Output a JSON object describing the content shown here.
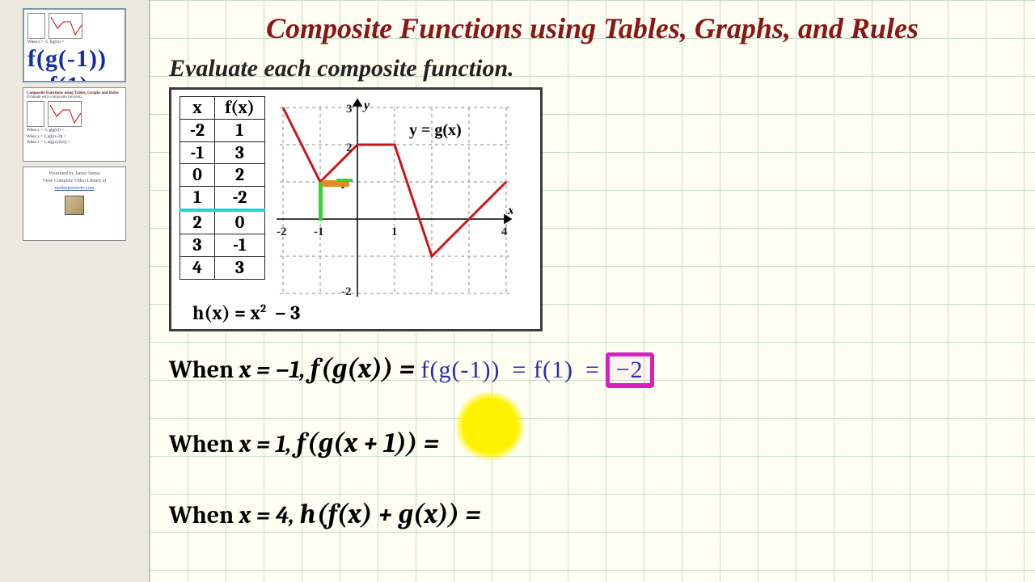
{
  "title": "Composite Functions using Tables, Graphs, and Rules",
  "subtitle": "Evaluate each composite function.",
  "sidebar": {
    "thumbs": [
      {
        "label": "slide-1"
      },
      {
        "label": "slide-2"
      },
      {
        "label": "slide-3-credits"
      }
    ],
    "credits": {
      "by": "Presented by James Sousa",
      "lib": "View Complete Video Library at"
    }
  },
  "table": {
    "head_x": "x",
    "head_fx": "f(x)",
    "rows": [
      {
        "x": "-2",
        "fx": "1"
      },
      {
        "x": "-1",
        "fx": "3"
      },
      {
        "x": "0",
        "fx": "2"
      },
      {
        "x": "1",
        "fx": "-2",
        "highlight": true
      },
      {
        "x": "2",
        "fx": "0"
      },
      {
        "x": "3",
        "fx": "-1"
      },
      {
        "x": "4",
        "fx": "3"
      }
    ]
  },
  "graph": {
    "label": "y = g(x)",
    "x_axis": "x",
    "y_axis": "y",
    "ticks_x": [
      "-2",
      "-1",
      "1",
      "4"
    ],
    "ticks_y": [
      "-2",
      "1",
      "2",
      "3"
    ]
  },
  "h_func": "h(x) = x² − 3",
  "problems": {
    "p1": {
      "prefix": "When ",
      "cond": "x = −1,",
      "expr": "f(g(x)) =",
      "work1": "f(g(-1))",
      "work2": "= f(1)",
      "work3": "=",
      "answer": "−2"
    },
    "p2": {
      "prefix": "When ",
      "cond": "x = 1,",
      "expr": "f(g(x + 1)) ="
    },
    "p3": {
      "prefix": "When ",
      "cond": "x = 4,",
      "expr": "h(f(x) + g(x)) ="
    }
  },
  "chart_data": {
    "type": "line",
    "title": "y = g(x)",
    "xlabel": "x",
    "ylabel": "y",
    "xlim": [
      -2,
      4
    ],
    "ylim": [
      -2,
      3
    ],
    "series": [
      {
        "name": "g(x)",
        "x": [
          -2,
          -1,
          0,
          1,
          2,
          3,
          4
        ],
        "y": [
          3,
          1,
          2,
          2,
          -1,
          0,
          1
        ]
      }
    ]
  }
}
